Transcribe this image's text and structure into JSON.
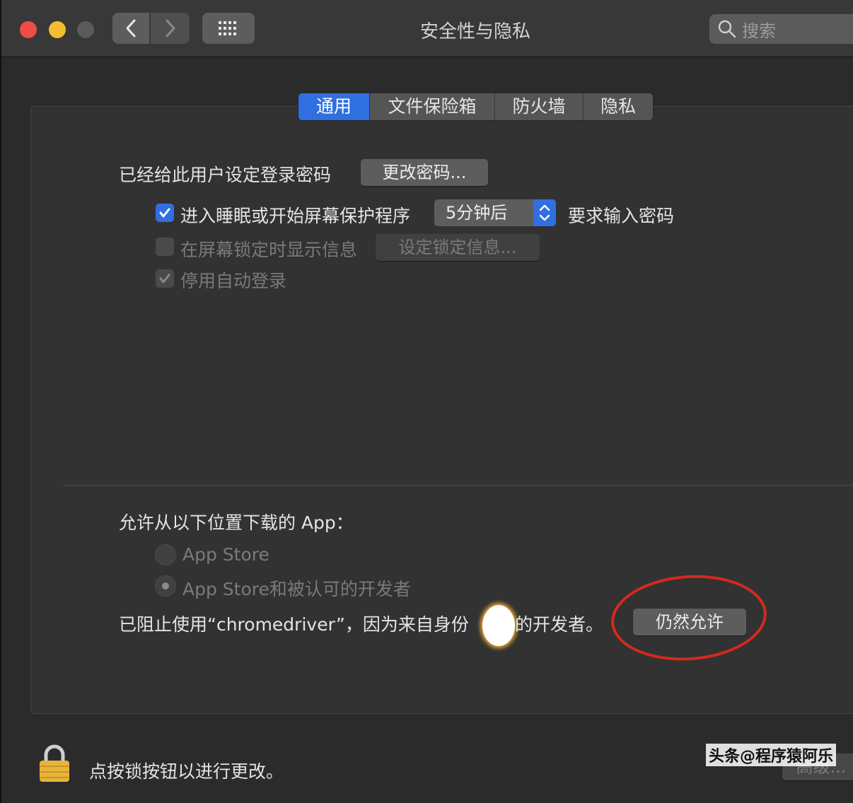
{
  "window": {
    "title": "安全性与隐私",
    "search_placeholder": "搜索"
  },
  "tabs": [
    {
      "label": "通用",
      "active": true
    },
    {
      "label": "文件保险箱",
      "active": false
    },
    {
      "label": "防火墙",
      "active": false
    },
    {
      "label": "隐私",
      "active": false
    }
  ],
  "general": {
    "password_label": "已经给此用户设定登录密码",
    "change_password_button": "更改密码...",
    "require_password": {
      "checked": true,
      "label": "进入睡眠或开始屏幕保护程序",
      "delay_value": "5分钟后",
      "suffix": "要求输入密码"
    },
    "show_message": {
      "checked": false,
      "label": "在屏幕锁定时显示信息",
      "button": "设定锁定信息..."
    },
    "disable_autologin": {
      "checked": true,
      "label": "停用自动登录"
    }
  },
  "downloads": {
    "heading": "允许从以下位置下载的 App：",
    "options": [
      {
        "label": "App Store",
        "selected": false
      },
      {
        "label": "App Store和被认可的开发者",
        "selected": true
      }
    ],
    "blocked_message_part1": "已阻止使用“chromedriver”，因为来自身份",
    "blocked_message_part2": "的开发者。",
    "allow_anyway_button": "仍然允许"
  },
  "footer": {
    "lock_text": "点按锁按钮以进行更改。",
    "advanced_button": "高级...",
    "watermark": "头条@程序猿阿乐"
  },
  "colors": {
    "accent": "#2f6fe0",
    "annotation_circle": "#d42a1e"
  }
}
